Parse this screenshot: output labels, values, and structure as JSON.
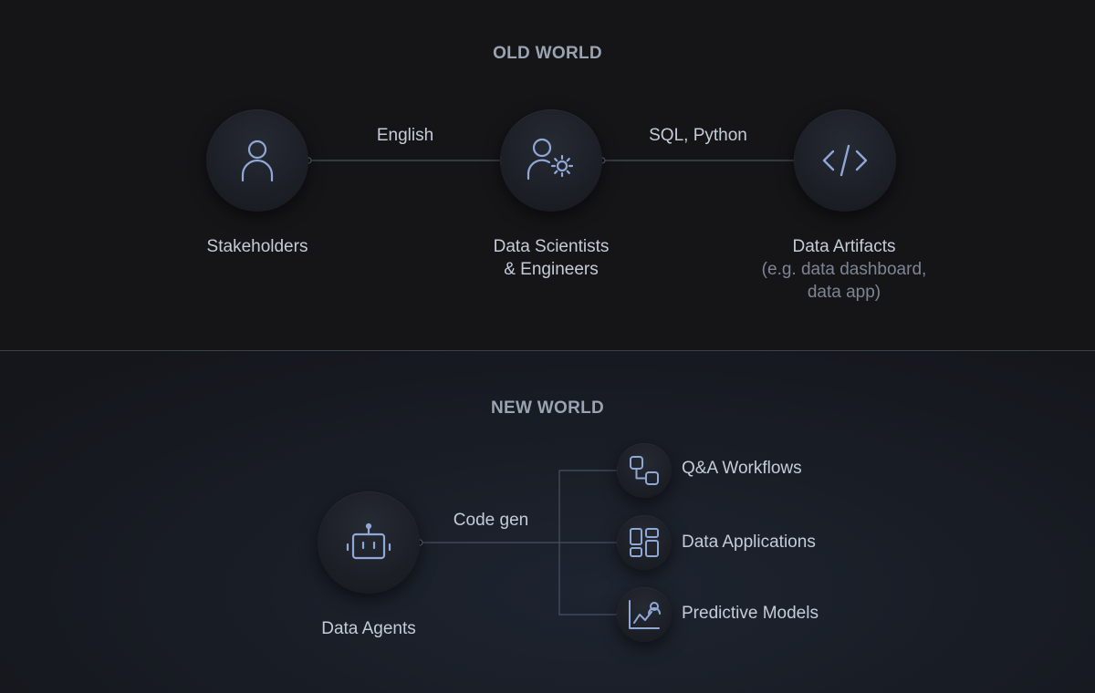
{
  "old_world": {
    "title": "OLD WORLD",
    "nodes": [
      {
        "label": "Stakeholders",
        "icon": "person-icon"
      },
      {
        "label_line1": "Data Scientists",
        "label_line2": "& Engineers",
        "icon": "person-gear-icon"
      },
      {
        "label": "Data Artifacts",
        "sub_line1": "(e.g. data dashboard,",
        "sub_line2": "data app)",
        "icon": "code-icon"
      }
    ],
    "edges": [
      {
        "label": "English"
      },
      {
        "label": "SQL, Python"
      }
    ]
  },
  "new_world": {
    "title": "NEW WORLD",
    "source": {
      "label": "Data Agents",
      "icon": "robot-icon"
    },
    "edge_label": "Code gen",
    "outputs": [
      {
        "label": "Q&A Workflows",
        "icon": "workflow-icon"
      },
      {
        "label": "Data Applications",
        "icon": "dashboard-icon"
      },
      {
        "label": "Predictive Models",
        "icon": "chart-model-icon"
      }
    ]
  },
  "colors": {
    "icon_stroke": "#8fa8d6",
    "line": "#4a5160",
    "title": "#9aa3b2",
    "text": "#c5ccd8",
    "subtext": "#7d8594"
  }
}
